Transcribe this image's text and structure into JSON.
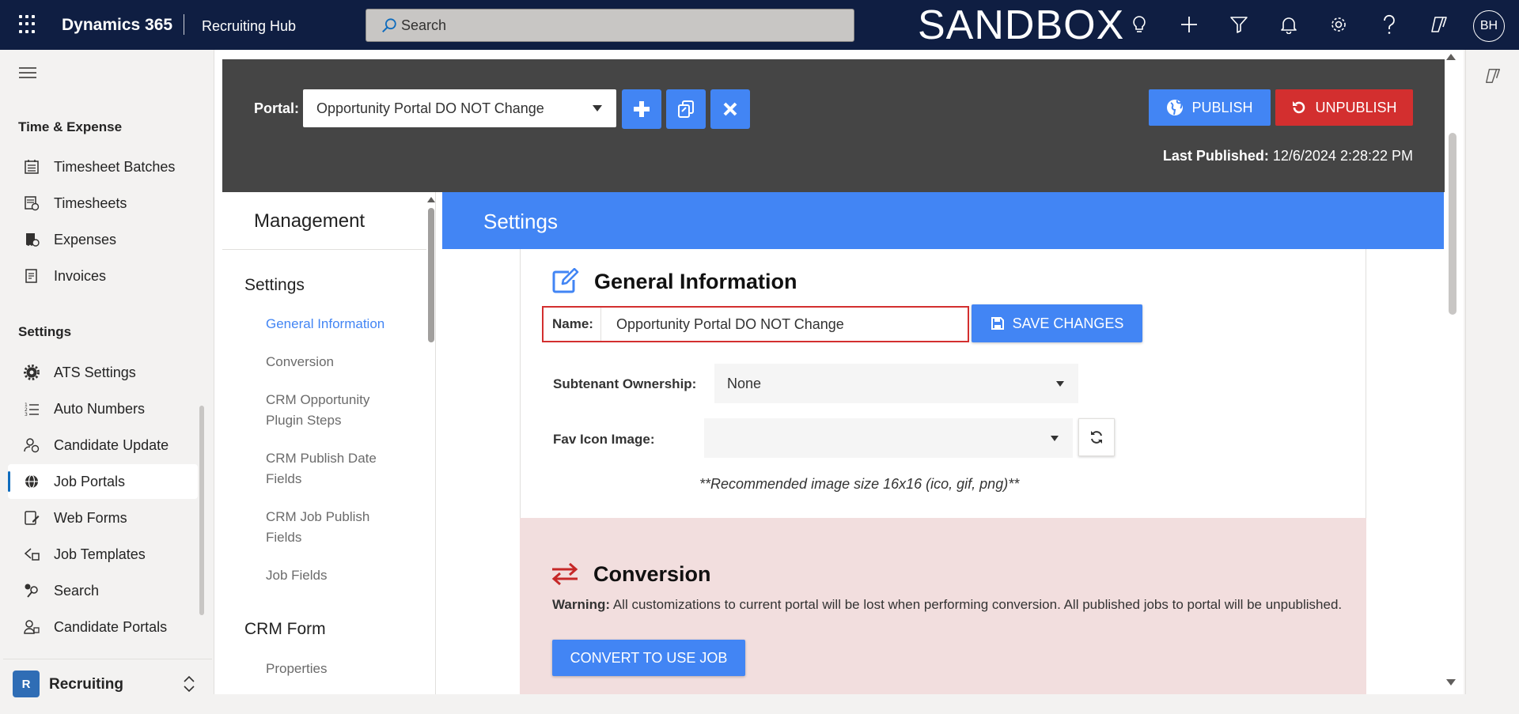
{
  "topbar": {
    "app_name": "Dynamics 365",
    "area_name": "Recruiting Hub",
    "search_placeholder": "Search",
    "environment_label": "SANDBOX",
    "avatar_initials": "BH"
  },
  "leftnav": {
    "groups": [
      {
        "label": "Time & Expense",
        "items": [
          "Timesheet Batches",
          "Timesheets",
          "Expenses",
          "Invoices"
        ]
      },
      {
        "label": "Settings",
        "items": [
          "ATS Settings",
          "Auto Numbers",
          "Candidate Update",
          "Job Portals",
          "Web Forms",
          "Job Templates",
          "Search",
          "Candidate Portals"
        ]
      }
    ],
    "active_item": "Job Portals",
    "area_badge": "R",
    "area_label": "Recruiting"
  },
  "portal_bar": {
    "portal_label": "Portal:",
    "portal_selected": "Opportunity Portal DO NOT Change",
    "publish_label": "PUBLISH",
    "unpublish_label": "UNPUBLISH",
    "last_published_label": "Last Published:",
    "last_published_value": "12/6/2024 2:28:22 PM"
  },
  "management": {
    "title": "Management",
    "sections": [
      {
        "label": "Settings",
        "links": [
          "General Information",
          "Conversion",
          "CRM Opportunity Plugin Steps",
          "CRM Publish Date Fields",
          "CRM Job Publish Fields",
          "Job Fields"
        ]
      },
      {
        "label": "CRM Form",
        "links": [
          "Properties"
        ]
      }
    ],
    "active_link": "General Information"
  },
  "content": {
    "header": "Settings",
    "general": {
      "title": "General Information",
      "name_label": "Name:",
      "name_value": "Opportunity Portal DO NOT Change",
      "save_label": "SAVE CHANGES",
      "subtenant_label": "Subtenant Ownership:",
      "subtenant_value": "None",
      "favicon_label": "Fav Icon Image:",
      "favicon_value": "",
      "favicon_hint": "**Recommended image size 16x16 (ico, gif, png)**"
    },
    "conversion": {
      "title": "Conversion",
      "warning_label": "Warning:",
      "warning_text": "All customizations to current portal will be lost when performing conversion. All published jobs to portal will be unpublished.",
      "button_label": "CONVERT TO USE JOB"
    }
  },
  "colors": {
    "topbar_bg": "#0f1e42",
    "primary_blue": "#4285f4",
    "danger_red": "#d32f2f",
    "portal_bar_bg": "#454545",
    "conversion_bg": "#f2dede"
  },
  "icons": {
    "topbar": [
      "lightbulb-icon",
      "plus-icon",
      "filter-icon",
      "bell-icon",
      "gear-icon",
      "help-icon",
      "copilot-icon"
    ]
  }
}
